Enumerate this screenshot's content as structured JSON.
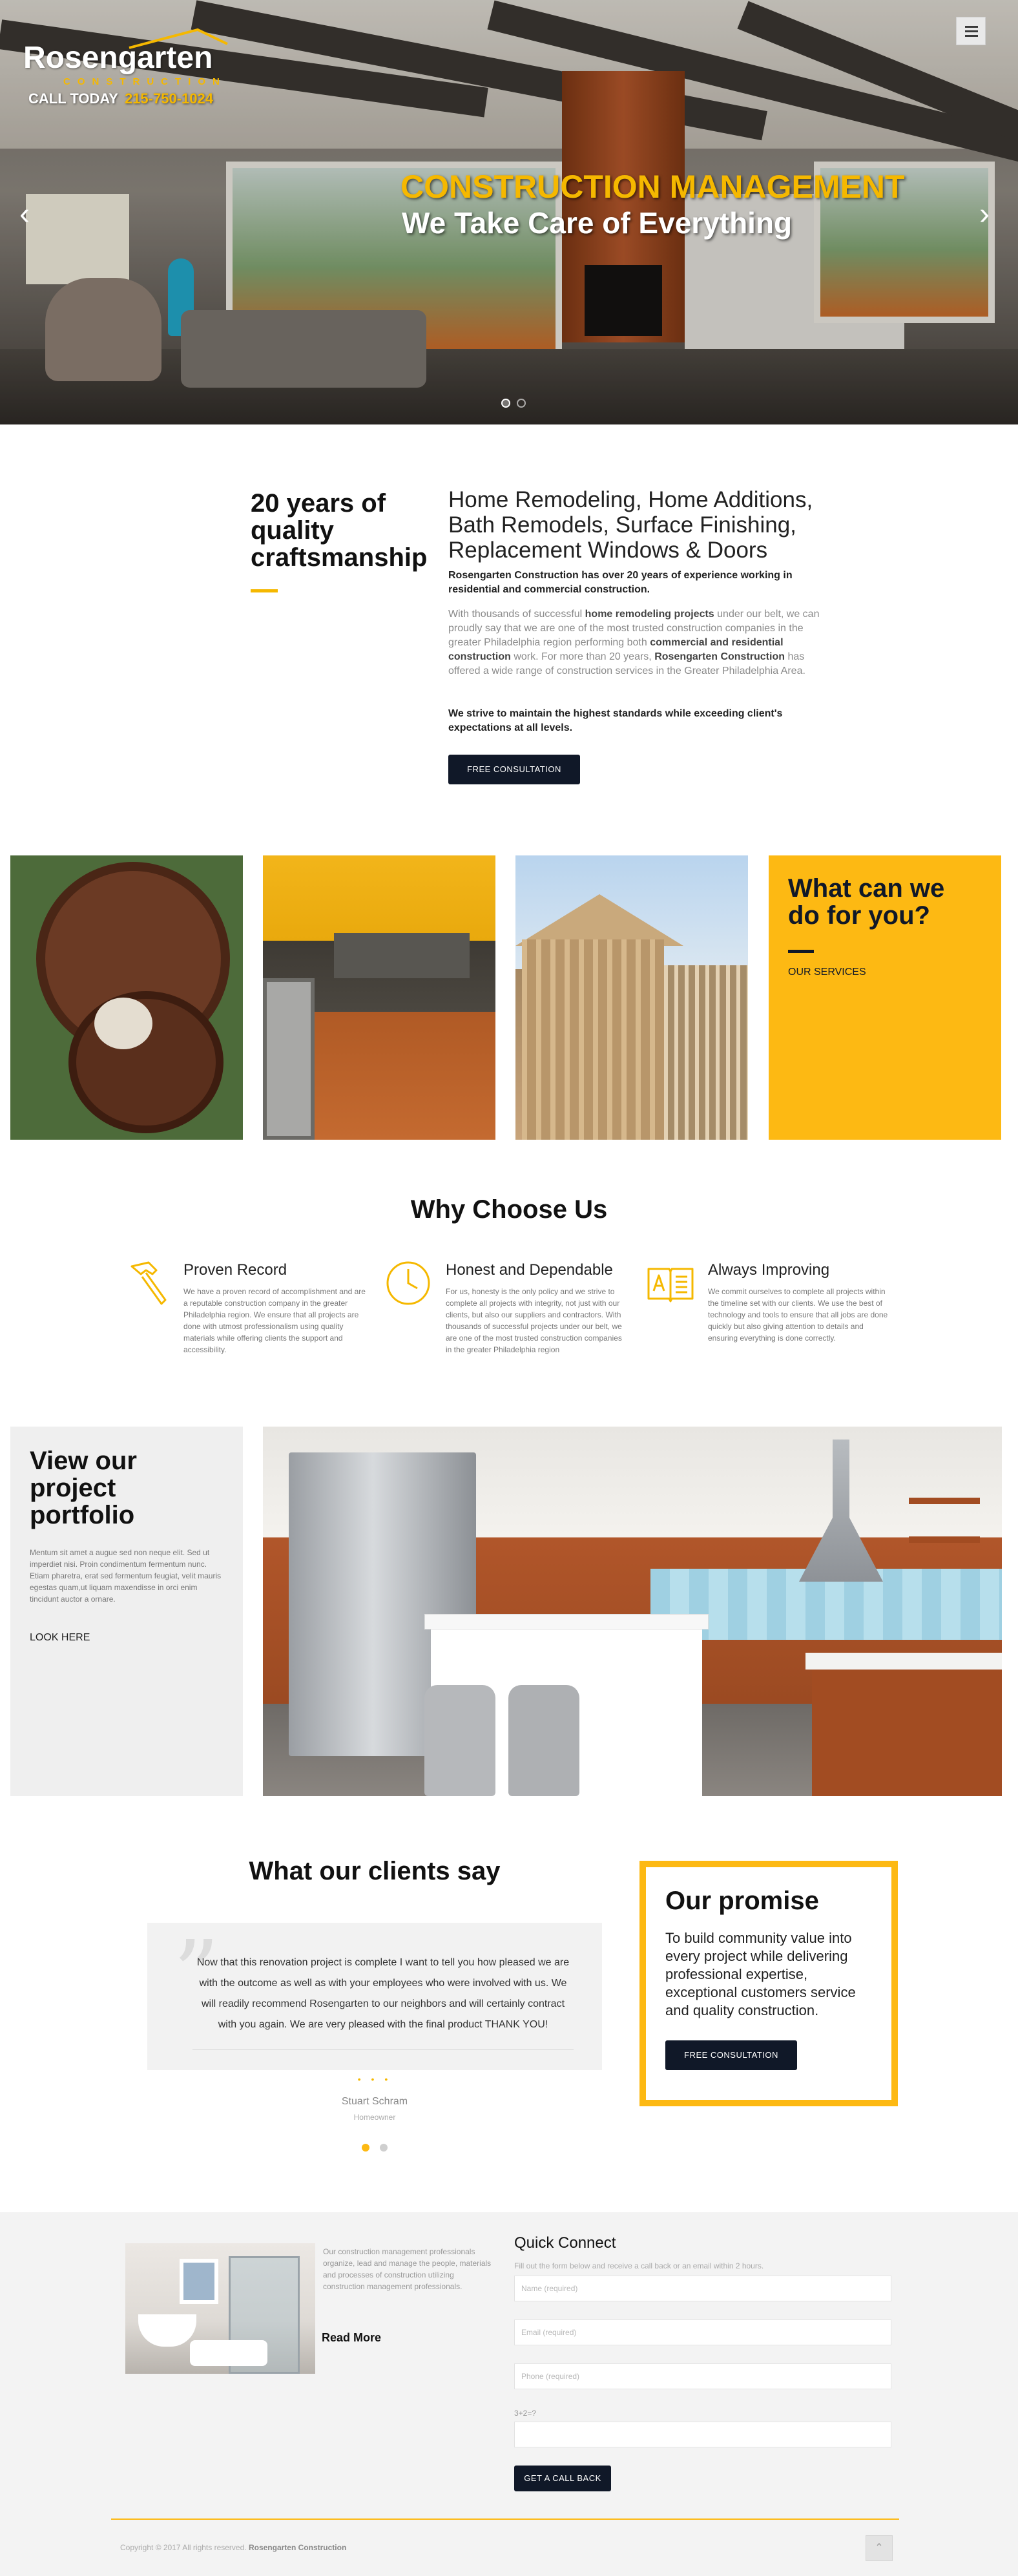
{
  "brand": {
    "name": "Rosengarten",
    "tagline": "CONSTRUCTION",
    "call_label": "CALL TODAY",
    "phone": "215-750-1024",
    "accent": "#fdb913",
    "dark": "#101828"
  },
  "hero": {
    "title": "CONSTRUCTION MANAGEMENT",
    "subtitle": "We Take Care of Everything",
    "prev_icon": "chevron-left-icon",
    "next_icon": "chevron-right-icon",
    "active_slide": 1,
    "slide_count": 2
  },
  "intro": {
    "heading": "20 years of quality craftsmanship",
    "title": "Home Remodeling, Home Additions, Bath Remodels, Surface Finishing, Replacement Windows & Doors",
    "lead": "Rosengarten Construction has over 20 years of experience working in residential and commercial construction.",
    "body_a": "With thousands of successful ",
    "body_b": "home remodeling projects",
    "body_c": " under our belt, we can proudly say that we are one of the most trusted construction companies in the greater Philadelphia region performing both ",
    "body_d": "commercial and residential construction",
    "body_e": " work. For more than 20 years, ",
    "body_f": "Rosengarten Construction",
    "body_g": " has offered a wide range of construction services in the Greater Philadelphia Area.",
    "closing": "We strive to maintain the highest standards while exceeding client's expectations at all levels.",
    "button": "FREE CONSULTATION"
  },
  "services_tile": {
    "title": "What can we do for you?",
    "link": "OUR SERVICES"
  },
  "why": {
    "title": "Why Choose Us",
    "features": [
      {
        "icon": "hammer-icon",
        "title": "Proven Record",
        "text": "We have a proven record of accomplishment and are a reputable construction company in the greater Philadelphia region. We ensure that all projects are done with utmost professionalism using quality materials while offering clients the support and accessibility."
      },
      {
        "icon": "clock-icon",
        "title": "Honest and Dependable",
        "text": "For us, honesty is the only policy and we strive to complete all projects with integrity, not just with our clients, but also our suppliers and contractors. With thousands of successful projects under our belt, we are one of the most trusted construction companies in the greater Philadelphia region"
      },
      {
        "icon": "book-icon",
        "title": "Always Improving",
        "text": "We commit ourselves to complete all projects within the timeline set with our clients. We use the best of technology and tools to ensure that all jobs are done quickly but also giving attention to details and ensuring everything is done correctly."
      }
    ]
  },
  "portfolio": {
    "title": "View our project portfolio",
    "text": "Mentum sit amet a augue sed non neque elit. Sed ut imperdiet nisi. Proin condimentum fermentum nunc. Etiam pharetra, erat sed fermentum feugiat, velit mauris egestas quam,ut liquam maxendisse in orci enim tincidunt auctor a ornare.",
    "link": "LOOK HERE"
  },
  "testimonials": {
    "title": "What our clients say",
    "quote": "Now that this renovation project is complete I want to tell you how pleased we are with the outcome as well as with your employees who were involved with us. We will readily recommend Rosengarten to our neighbors and will certainly contract with you again. We are very pleased with the final product THANK YOU!",
    "stars": "• • •",
    "name": "Stuart Schram",
    "role": "Homeowner",
    "active_index": 1,
    "count": 2
  },
  "promise": {
    "title": "Our promise",
    "text": "To build community value into every project while delivering professional expertise, exceptional customers service and quality construction.",
    "button": "FREE CONSULTATION"
  },
  "blog": {
    "text": "Our construction management professionals organize, lead and manage the people, materials and processes of construction utilizing construction management professionals.",
    "link": "Read More"
  },
  "quick_connect": {
    "title": "Quick Connect",
    "subtitle": "Fill out the form below and receive a call back or an email within 2 hours.",
    "name_placeholder": "Name (required)",
    "email_placeholder": "Email (required)",
    "phone_placeholder": "Phone (required)",
    "captcha_label": "3+2=?",
    "button": "GET A CALL BACK"
  },
  "footer": {
    "copyright": "Copyright © 2017 All rights reserved.",
    "company": "Rosengarten Construction",
    "top_icon": "chevron-up-icon"
  }
}
